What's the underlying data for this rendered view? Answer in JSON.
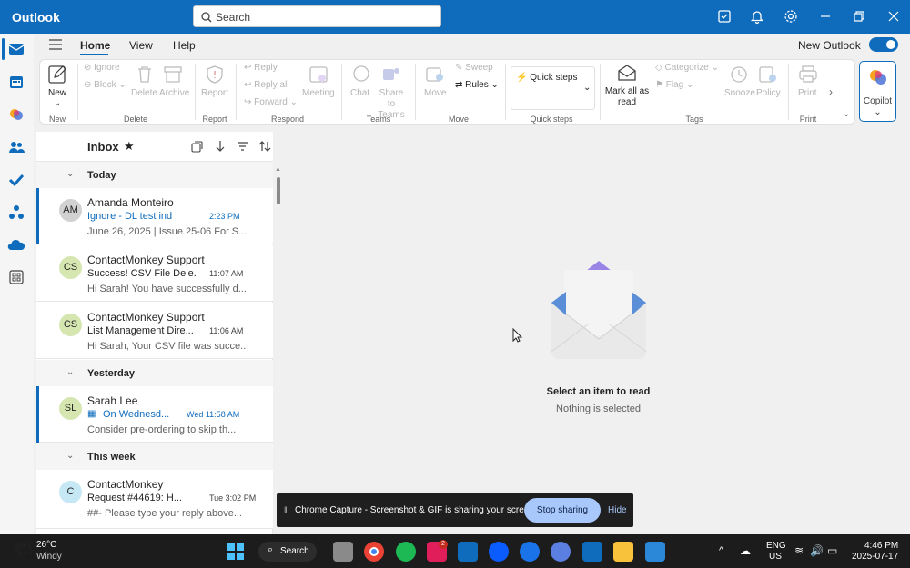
{
  "titlebar": {
    "app_name": "Outlook",
    "search_placeholder": "Search"
  },
  "tabs": [
    {
      "label": "Home"
    },
    {
      "label": "View"
    },
    {
      "label": "Help"
    }
  ],
  "new_outlook": {
    "label": "New Outlook",
    "enabled": true
  },
  "ribbon": {
    "new": {
      "label": "New",
      "group": "New"
    },
    "delete_group": {
      "label": "Delete",
      "ignore": "Ignore",
      "block": "Block",
      "delete": "Delete",
      "archive": "Archive"
    },
    "report_group": {
      "label": "Report",
      "report": "Report"
    },
    "respond_group": {
      "label": "Respond",
      "reply": "Reply",
      "reply_all": "Reply all",
      "forward": "Forward",
      "meeting": "Meeting"
    },
    "teams_group": {
      "label": "Teams",
      "chat": "Chat",
      "share_to_teams": "Share to Teams"
    },
    "move_group": {
      "label": "Move",
      "move": "Move",
      "sweep": "Sweep",
      "rules": "Rules"
    },
    "quick_steps_group": {
      "label": "Quick steps",
      "quick_steps": "Quick steps"
    },
    "tags_group": {
      "label": "Tags",
      "mark_all_as_read": "Mark all as read",
      "categorize": "Categorize",
      "flag": "Flag",
      "snooze": "Snooze",
      "policy": "Policy"
    },
    "print_group": {
      "label": "Print",
      "print": "Print"
    },
    "copilot": "Copilot"
  },
  "list": {
    "title": "Inbox",
    "groups": [
      {
        "label": "Today",
        "messages": [
          {
            "initials": "AM",
            "sender": "Amanda Monteiro",
            "subject": "Ignore - DL test ind",
            "time": "2:23 PM",
            "preview": "June 26, 2025 | Issue 25-06 For S...",
            "avatar_color": "#d1d1d1",
            "selected": true,
            "unread": true
          },
          {
            "initials": "CS",
            "sender": "ContactMonkey Support",
            "subject": "Success! CSV File Dele...",
            "time": "11:07 AM",
            "preview": "Hi Sarah! You have successfully d...",
            "avatar_color": "#d5e6b0"
          },
          {
            "initials": "CS",
            "sender": "ContactMonkey Support",
            "subject": "List Management Dire...",
            "time": "11:06 AM",
            "preview": "Hi Sarah, Your CSV file was succe...",
            "avatar_color": "#d5e6b0"
          }
        ]
      },
      {
        "label": "Yesterday",
        "messages": [
          {
            "initials": "SL",
            "sender": "Sarah Lee",
            "subject": "On Wednesd...",
            "time": "Wed 11:58 AM",
            "preview": "Consider pre-ordering to skip th...",
            "avatar_color": "#d5e6b0",
            "selected": true,
            "unread": true,
            "calendar": true
          }
        ]
      },
      {
        "label": "This week",
        "messages": [
          {
            "initials": "C",
            "sender": "ContactMonkey",
            "subject": "Request #44619: H...",
            "time": "Tue 3:02 PM",
            "preview": "##- Please type your reply above...",
            "avatar_color": "#c6e8f5"
          }
        ]
      }
    ]
  },
  "reading_pane": {
    "title": "Select an item to read",
    "subtitle": "Nothing is selected"
  },
  "share_bar": {
    "text": "Chrome Capture - Screenshot & GIF is sharing your screen.",
    "stop": "Stop sharing",
    "hide": "Hide"
  },
  "taskbar": {
    "weather_temp": "26°C",
    "weather_desc": "Windy",
    "search": "Search",
    "lang1": "ENG",
    "lang2": "US",
    "time": "4:46 PM",
    "date": "2025-07-17",
    "badge": "2"
  },
  "colors": {
    "accent": "#0f6cbd",
    "titlebar": "#0f6cbd"
  }
}
